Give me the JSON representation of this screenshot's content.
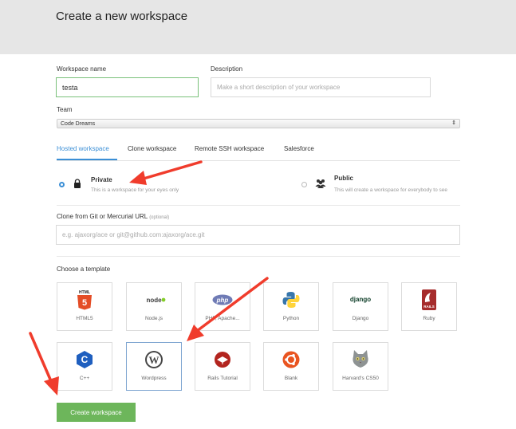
{
  "header": {
    "title": "Create a new workspace"
  },
  "form": {
    "name_label": "Workspace name",
    "name_value": "testa",
    "desc_label": "Description",
    "desc_placeholder": "Make a short description of your workspace",
    "team_label": "Team",
    "team_value": "Code Dreams"
  },
  "tabs": [
    "Hosted workspace",
    "Clone workspace",
    "Remote SSH workspace",
    "Salesforce"
  ],
  "visibility": {
    "private_title": "Private",
    "private_desc": "This is a workspace for your eyes only",
    "public_title": "Public",
    "public_desc": "This will create a workspace for everybody to see"
  },
  "clone": {
    "label": "Clone from Git or Mercurial URL",
    "optional": "(optional)",
    "placeholder": "e.g. ajaxorg/ace or git@github.com:ajaxorg/ace.git"
  },
  "templates_label": "Choose a template",
  "templates": [
    {
      "name": "HTML5",
      "icon": "html5-icon"
    },
    {
      "name": "Node.js",
      "icon": "nodejs-icon"
    },
    {
      "name": "PHP, Apache...",
      "icon": "php-icon"
    },
    {
      "name": "Python",
      "icon": "python-icon"
    },
    {
      "name": "Django",
      "icon": "django-icon"
    },
    {
      "name": "Ruby",
      "icon": "rails-icon"
    },
    {
      "name": "C++",
      "icon": "cpp-icon"
    },
    {
      "name": "Wordpress",
      "icon": "wordpress-icon"
    },
    {
      "name": "Rails Tutorial",
      "icon": "rails-tutorial-icon"
    },
    {
      "name": "Blank",
      "icon": "ubuntu-icon"
    },
    {
      "name": "Harvard's CS50",
      "icon": "cs50-cat-icon"
    }
  ],
  "selected_template": "Wordpress",
  "submit_label": "Create workspace",
  "colors": {
    "accent": "#3b8fd6",
    "button": "#6db65b",
    "annotation_arrow": "#f03c2c"
  }
}
